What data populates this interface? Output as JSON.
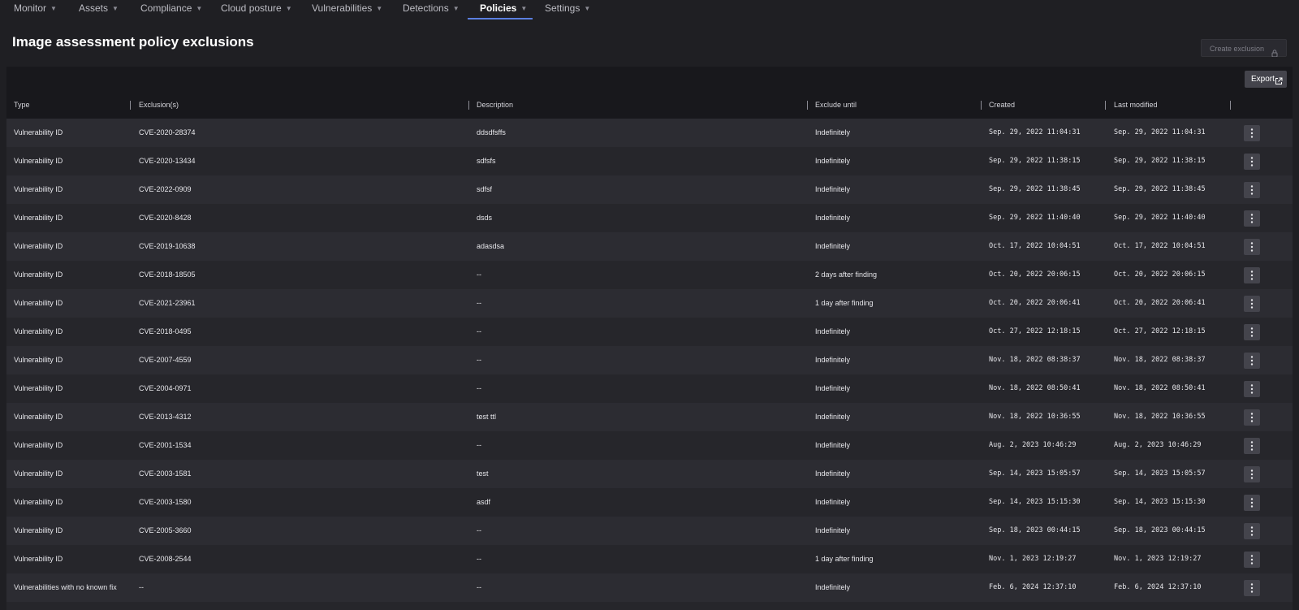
{
  "nav": {
    "items": [
      {
        "label": "Monitor"
      },
      {
        "label": "Assets"
      },
      {
        "label": "Compliance"
      },
      {
        "label": "Cloud posture"
      },
      {
        "label": "Vulnerabilities"
      },
      {
        "label": "Detections"
      },
      {
        "label": "Policies"
      },
      {
        "label": "Settings"
      }
    ],
    "active_index": 6
  },
  "page": {
    "title": "Image assessment policy exclusions",
    "create_label": "Create exclusion"
  },
  "toolbar": {
    "export_label": "Export"
  },
  "table": {
    "headers": {
      "type": "Type",
      "exclusions": "Exclusion(s)",
      "description": "Description",
      "exclude_until": "Exclude until",
      "created": "Created",
      "last_modified": "Last modified"
    },
    "rows": [
      {
        "type": "Vulnerability ID",
        "exclusion": "CVE-2020-28374",
        "description": "ddsdfsffs",
        "until": "Indefinitely",
        "created": "Sep. 29, 2022 11:04:31",
        "modified": "Sep. 29, 2022 11:04:31"
      },
      {
        "type": "Vulnerability ID",
        "exclusion": "CVE-2020-13434",
        "description": "sdfsfs",
        "until": "Indefinitely",
        "created": "Sep. 29, 2022 11:38:15",
        "modified": "Sep. 29, 2022 11:38:15"
      },
      {
        "type": "Vulnerability ID",
        "exclusion": "CVE-2022-0909",
        "description": "sdfsf",
        "until": "Indefinitely",
        "created": "Sep. 29, 2022 11:38:45",
        "modified": "Sep. 29, 2022 11:38:45"
      },
      {
        "type": "Vulnerability ID",
        "exclusion": "CVE-2020-8428",
        "description": "dsds",
        "until": "Indefinitely",
        "created": "Sep. 29, 2022 11:40:40",
        "modified": "Sep. 29, 2022 11:40:40"
      },
      {
        "type": "Vulnerability ID",
        "exclusion": "CVE-2019-10638",
        "description": "adasdsa",
        "until": "Indefinitely",
        "created": "Oct. 17, 2022 10:04:51",
        "modified": "Oct. 17, 2022 10:04:51"
      },
      {
        "type": "Vulnerability ID",
        "exclusion": "CVE-2018-18505",
        "description": "--",
        "until": "2 days after finding",
        "created": "Oct. 20, 2022 20:06:15",
        "modified": "Oct. 20, 2022 20:06:15"
      },
      {
        "type": "Vulnerability ID",
        "exclusion": "CVE-2021-23961",
        "description": "--",
        "until": "1 day after finding",
        "created": "Oct. 20, 2022 20:06:41",
        "modified": "Oct. 20, 2022 20:06:41"
      },
      {
        "type": "Vulnerability ID",
        "exclusion": "CVE-2018-0495",
        "description": "--",
        "until": "Indefinitely",
        "created": "Oct. 27, 2022 12:18:15",
        "modified": "Oct. 27, 2022 12:18:15"
      },
      {
        "type": "Vulnerability ID",
        "exclusion": "CVE-2007-4559",
        "description": "--",
        "until": "Indefinitely",
        "created": "Nov. 18, 2022 08:38:37",
        "modified": "Nov. 18, 2022 08:38:37"
      },
      {
        "type": "Vulnerability ID",
        "exclusion": "CVE-2004-0971",
        "description": "--",
        "until": "Indefinitely",
        "created": "Nov. 18, 2022 08:50:41",
        "modified": "Nov. 18, 2022 08:50:41"
      },
      {
        "type": "Vulnerability ID",
        "exclusion": "CVE-2013-4312",
        "description": "test ttl",
        "until": "Indefinitely",
        "created": "Nov. 18, 2022 10:36:55",
        "modified": "Nov. 18, 2022 10:36:55"
      },
      {
        "type": "Vulnerability ID",
        "exclusion": "CVE-2001-1534",
        "description": "--",
        "until": "Indefinitely",
        "created": "Aug. 2, 2023 10:46:29",
        "modified": "Aug. 2, 2023 10:46:29"
      },
      {
        "type": "Vulnerability ID",
        "exclusion": "CVE-2003-1581",
        "description": "test",
        "until": "Indefinitely",
        "created": "Sep. 14, 2023 15:05:57",
        "modified": "Sep. 14, 2023 15:05:57"
      },
      {
        "type": "Vulnerability ID",
        "exclusion": "CVE-2003-1580",
        "description": "asdf",
        "until": "Indefinitely",
        "created": "Sep. 14, 2023 15:15:30",
        "modified": "Sep. 14, 2023 15:15:30"
      },
      {
        "type": "Vulnerability ID",
        "exclusion": "CVE-2005-3660",
        "description": "--",
        "until": "Indefinitely",
        "created": "Sep. 18, 2023 00:44:15",
        "modified": "Sep. 18, 2023 00:44:15"
      },
      {
        "type": "Vulnerability ID",
        "exclusion": "CVE-2008-2544",
        "description": "--",
        "until": "1 day after finding",
        "created": "Nov. 1, 2023 12:19:27",
        "modified": "Nov. 1, 2023 12:19:27"
      },
      {
        "type": "Vulnerabilities with no known fix",
        "exclusion": "--",
        "description": "--",
        "until": "Indefinitely",
        "created": "Feb. 6, 2024 12:37:10",
        "modified": "Feb. 6, 2024 12:37:10"
      }
    ]
  },
  "icons": {
    "nav_chevron": "chevron-down-icon",
    "create": "lock-icon",
    "export": "external-link-icon",
    "row_menu": "more-vertical-icon"
  },
  "colors": {
    "accent": "#5b7fe0",
    "background": "#1f1f23",
    "table_header": "#18181c",
    "row_odd": "#26262b",
    "row_even": "#2c2c32",
    "button": "#44444c"
  }
}
